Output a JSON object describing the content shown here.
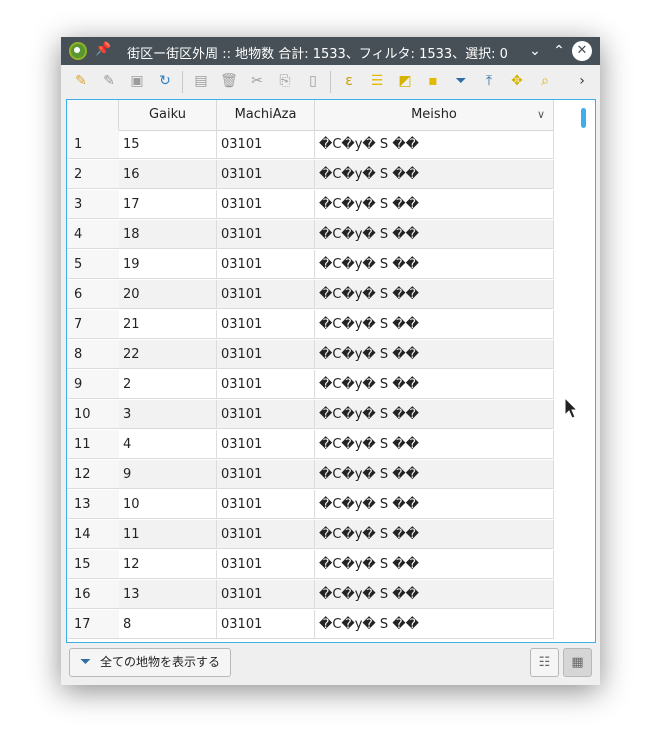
{
  "window": {
    "title": "街区ー街区外周 :: 地物数 合計: 1533、フィルタ: 1533、選択: 0",
    "pin_icon": "pin-icon",
    "controls": [
      "chevron-down-icon",
      "chevron-up-icon",
      "close-icon"
    ],
    "chevron_down": "⌄",
    "chevron_up": "⌃",
    "close": "✕"
  },
  "toolbar": {
    "icons": [
      "toggle-editing-icon",
      "multi-edit-icon",
      "save-edits-icon",
      "reload-icon",
      "add-feature-icon",
      "delete-feature-icon",
      "cut-icon",
      "copy-icon",
      "paste-icon",
      "expression-select-icon",
      "select-all-icon",
      "invert-selection-icon",
      "deselect-icon",
      "filter-icon",
      "move-selection-top-icon",
      "pan-to-selection-icon",
      "zoom-to-selection-icon",
      "more-icon"
    ]
  },
  "table": {
    "columns": [
      "Gaiku",
      "MachiAza",
      "Meisho"
    ],
    "sort_indicator": "chevron-down-icon",
    "rows": [
      {
        "n": "1",
        "gaiku": "15",
        "machiaza": "03101",
        "meisho": "�C�y� S ��"
      },
      {
        "n": "2",
        "gaiku": "16",
        "machiaza": "03101",
        "meisho": "�C�y� S ��"
      },
      {
        "n": "3",
        "gaiku": "17",
        "machiaza": "03101",
        "meisho": "�C�y� S ��"
      },
      {
        "n": "4",
        "gaiku": "18",
        "machiaza": "03101",
        "meisho": "�C�y� S ��"
      },
      {
        "n": "5",
        "gaiku": "19",
        "machiaza": "03101",
        "meisho": "�C�y� S ��"
      },
      {
        "n": "6",
        "gaiku": "20",
        "machiaza": "03101",
        "meisho": "�C�y� S ��"
      },
      {
        "n": "7",
        "gaiku": "21",
        "machiaza": "03101",
        "meisho": "�C�y� S ��"
      },
      {
        "n": "8",
        "gaiku": "22",
        "machiaza": "03101",
        "meisho": "�C�y� S ��"
      },
      {
        "n": "9",
        "gaiku": "2",
        "machiaza": "03101",
        "meisho": "�C�y� S ��"
      },
      {
        "n": "10",
        "gaiku": "3",
        "machiaza": "03101",
        "meisho": "�C�y� S ��"
      },
      {
        "n": "11",
        "gaiku": "4",
        "machiaza": "03101",
        "meisho": "�C�y� S ��"
      },
      {
        "n": "12",
        "gaiku": "9",
        "machiaza": "03101",
        "meisho": "�C�y� S ��"
      },
      {
        "n": "13",
        "gaiku": "10",
        "machiaza": "03101",
        "meisho": "�C�y� S ��"
      },
      {
        "n": "14",
        "gaiku": "11",
        "machiaza": "03101",
        "meisho": "�C�y� S ��"
      },
      {
        "n": "15",
        "gaiku": "12",
        "machiaza": "03101",
        "meisho": "�C�y� S ��"
      },
      {
        "n": "16",
        "gaiku": "13",
        "machiaza": "03101",
        "meisho": "�C�y� S ��"
      },
      {
        "n": "17",
        "gaiku": "8",
        "machiaza": "03101",
        "meisho": "�C�y� S ��"
      }
    ]
  },
  "footer": {
    "filter_button_label": "全ての地物を表示する",
    "filter_icon": "filter-icon",
    "view_buttons": [
      "form-view-icon",
      "table-view-icon"
    ]
  },
  "colors": {
    "titlebar": "#475057",
    "accent": "#3daee9",
    "qgis_green": "#589632"
  }
}
